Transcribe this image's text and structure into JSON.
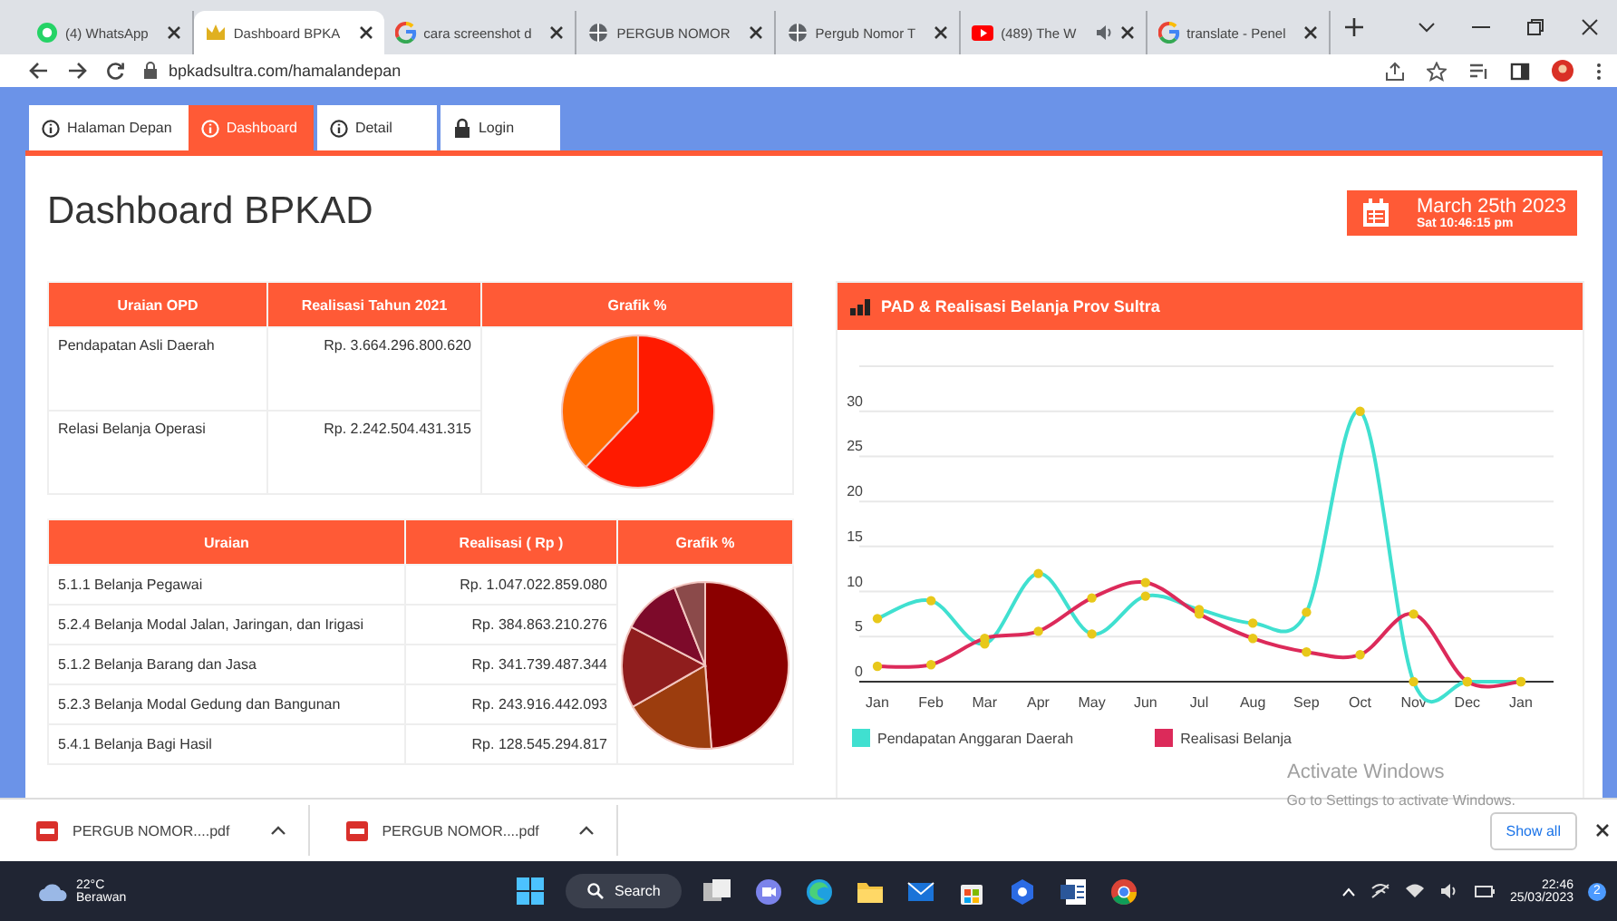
{
  "browser": {
    "tabs": [
      {
        "title": "(4) WhatsApp",
        "kind": "whatsapp",
        "selected": false,
        "audio": false
      },
      {
        "title": "Dashboard BPKA",
        "kind": "crown",
        "selected": true,
        "audio": false
      },
      {
        "title": "cara screenshot d",
        "kind": "google",
        "selected": false,
        "audio": false
      },
      {
        "title": "PERGUB NOMOR",
        "kind": "globe",
        "selected": false,
        "audio": false
      },
      {
        "title": "Pergub Nomor T",
        "kind": "globe",
        "selected": false,
        "audio": false
      },
      {
        "title": "(489) The W",
        "kind": "youtube",
        "selected": false,
        "audio": true
      },
      {
        "title": "translate - Penel",
        "kind": "google",
        "selected": false,
        "audio": false
      }
    ],
    "address": "bpkadsultra.com/hamalandepan"
  },
  "nav_tabs": [
    {
      "label": "Halaman Depan",
      "kind": "info",
      "selected": false
    },
    {
      "label": "Dashboard",
      "kind": "info",
      "selected": true
    },
    {
      "label": "Detail",
      "kind": "info",
      "selected": false
    },
    {
      "label": "Login",
      "kind": "lock",
      "selected": false
    }
  ],
  "page_title": "Dashboard BPKAD",
  "date_box": {
    "date": "March 25th 2023",
    "time": "Sat 10:46:15 pm"
  },
  "opd_table": {
    "columns": [
      "Uraian OPD",
      "Realisasi Tahun 2021",
      "Grafik %"
    ],
    "rows": [
      {
        "name": "Pendapatan Asli Daerah",
        "value": "Rp. 3.664.296.800.620"
      },
      {
        "name": "Relasi Belanja Operasi",
        "value": "Rp. 2.242.504.431.315"
      }
    ],
    "chart_data": {
      "type": "pie",
      "values": [
        62.04,
        37.96
      ],
      "colors": [
        "#ff1a00",
        "#ff6a00"
      ]
    }
  },
  "belanja_table": {
    "columns": [
      "Uraian",
      "Realisasi ( Rp )",
      "Grafik %"
    ],
    "rows": [
      {
        "name": "5.1.1 Belanja Pegawai",
        "value": "Rp. 1.047.022.859.080"
      },
      {
        "name": "5.2.4 Belanja Modal Jalan, Jaringan, dan Irigasi",
        "value": "Rp. 384.863.210.276"
      },
      {
        "name": "5.1.2 Belanja Barang dan Jasa",
        "value": "Rp. 341.739.487.344"
      },
      {
        "name": "5.2.3 Belanja Modal Gedung dan Bangunan",
        "value": "Rp. 243.916.442.093"
      },
      {
        "name": "5.4.1 Belanja Bagi Hasil",
        "value": "Rp. 128.545.294.817"
      }
    ],
    "chart_data": {
      "type": "pie",
      "values": [
        48.79,
        17.93,
        15.92,
        11.37,
        5.99
      ],
      "colors": [
        "#8b0000",
        "#9c3d0e",
        "#8f1d1d",
        "#7d0a2a",
        "#8b4a4a"
      ]
    }
  },
  "line_panel": {
    "title": "PAD & Realisasi Belanja Prov Sultra",
    "chart_data": {
      "type": "line",
      "categories": [
        "Jan",
        "Feb",
        "Mar",
        "Apr",
        "May",
        "Jun",
        "Jul",
        "Aug",
        "Sep",
        "Oct",
        "Nov",
        "Dec",
        "Jan"
      ],
      "ylim": [
        0,
        35
      ],
      "yticks": [
        0,
        5,
        10,
        15,
        20,
        25,
        30
      ],
      "grid": true,
      "series": [
        {
          "name": "Pendapatan Anggaran Daerah",
          "color": "#40e0d0",
          "marker": true,
          "values": [
            7,
            9,
            4.2,
            12,
            5.3,
            9.5,
            8,
            6.5,
            7.7,
            30,
            0,
            0,
            0
          ]
        },
        {
          "name": "Realisasi Belanja",
          "color": "#dc2a5a",
          "marker": true,
          "values": [
            1.7,
            1.9,
            4.8,
            5.6,
            9.3,
            11,
            7.5,
            4.8,
            3.3,
            3,
            7.5,
            0,
            0
          ]
        }
      ]
    }
  },
  "os_notice": {
    "title": "Activate Windows",
    "text": "Go to Settings to activate Windows."
  },
  "downloads": {
    "items": [
      "PERGUB NOMOR....pdf",
      "PERGUB NOMOR....pdf"
    ],
    "show_all": "Show all"
  },
  "taskbar": {
    "temperature": "22°C",
    "weather": "Berawan",
    "search": "Search",
    "time": "22:46",
    "date": "25/03/2023",
    "notifications": "2"
  }
}
